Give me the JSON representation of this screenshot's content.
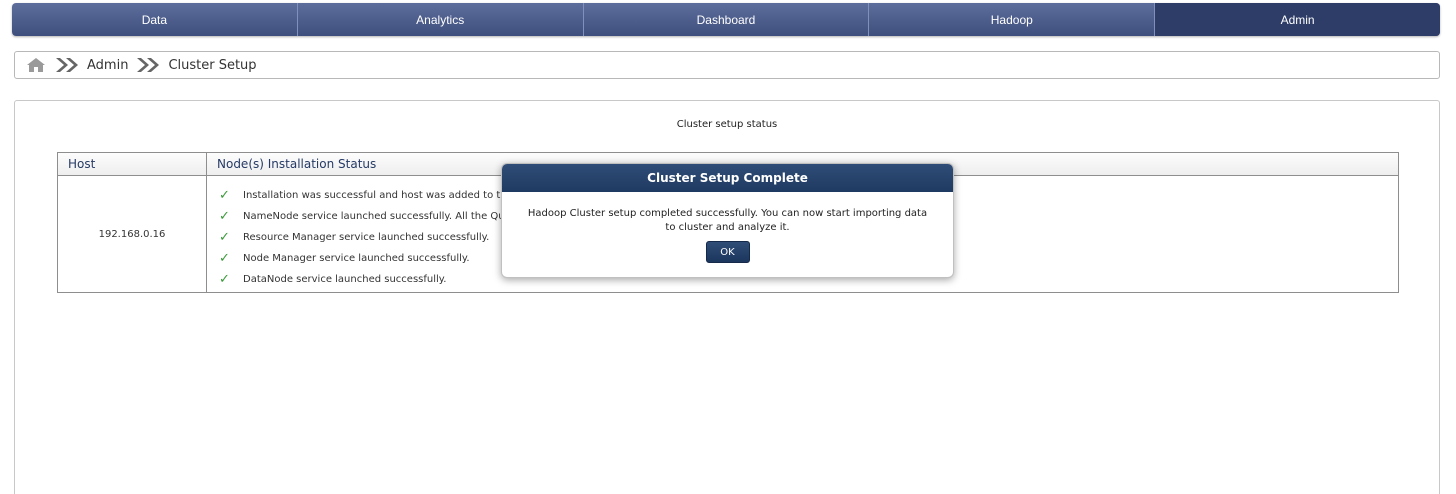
{
  "nav": {
    "tabs": [
      {
        "label": "Data",
        "active": false
      },
      {
        "label": "Analytics",
        "active": false
      },
      {
        "label": "Dashboard",
        "active": false
      },
      {
        "label": "Hadoop",
        "active": false
      },
      {
        "label": "Admin",
        "active": true
      }
    ]
  },
  "breadcrumb": {
    "home_icon": "home-icon",
    "separator_icon": "double-chevron-right-icon",
    "items": [
      "Admin",
      "Cluster Setup"
    ]
  },
  "panel": {
    "title": "Cluster setup status"
  },
  "table": {
    "headers": {
      "host": "Host",
      "status": "Node(s) Installation Status"
    },
    "rows": [
      {
        "host": "192.168.0.16",
        "statuses": [
          "Installation was successful and host was added to the",
          "NameNode service launched successfully. All the Que",
          "Resource Manager service launched successfully.",
          "Node Manager service launched successfully.",
          "DataNode service launched successfully."
        ]
      }
    ]
  },
  "modal": {
    "title": "Cluster Setup Complete",
    "message": "Hadoop Cluster setup completed successfully. You can now start importing data to cluster and analyze it.",
    "ok_label": "OK"
  },
  "colors": {
    "nav_bg": "#4a5a88",
    "nav_active": "#2e3d68",
    "modal_header": "#27456f",
    "check": "#3a9a3a"
  }
}
